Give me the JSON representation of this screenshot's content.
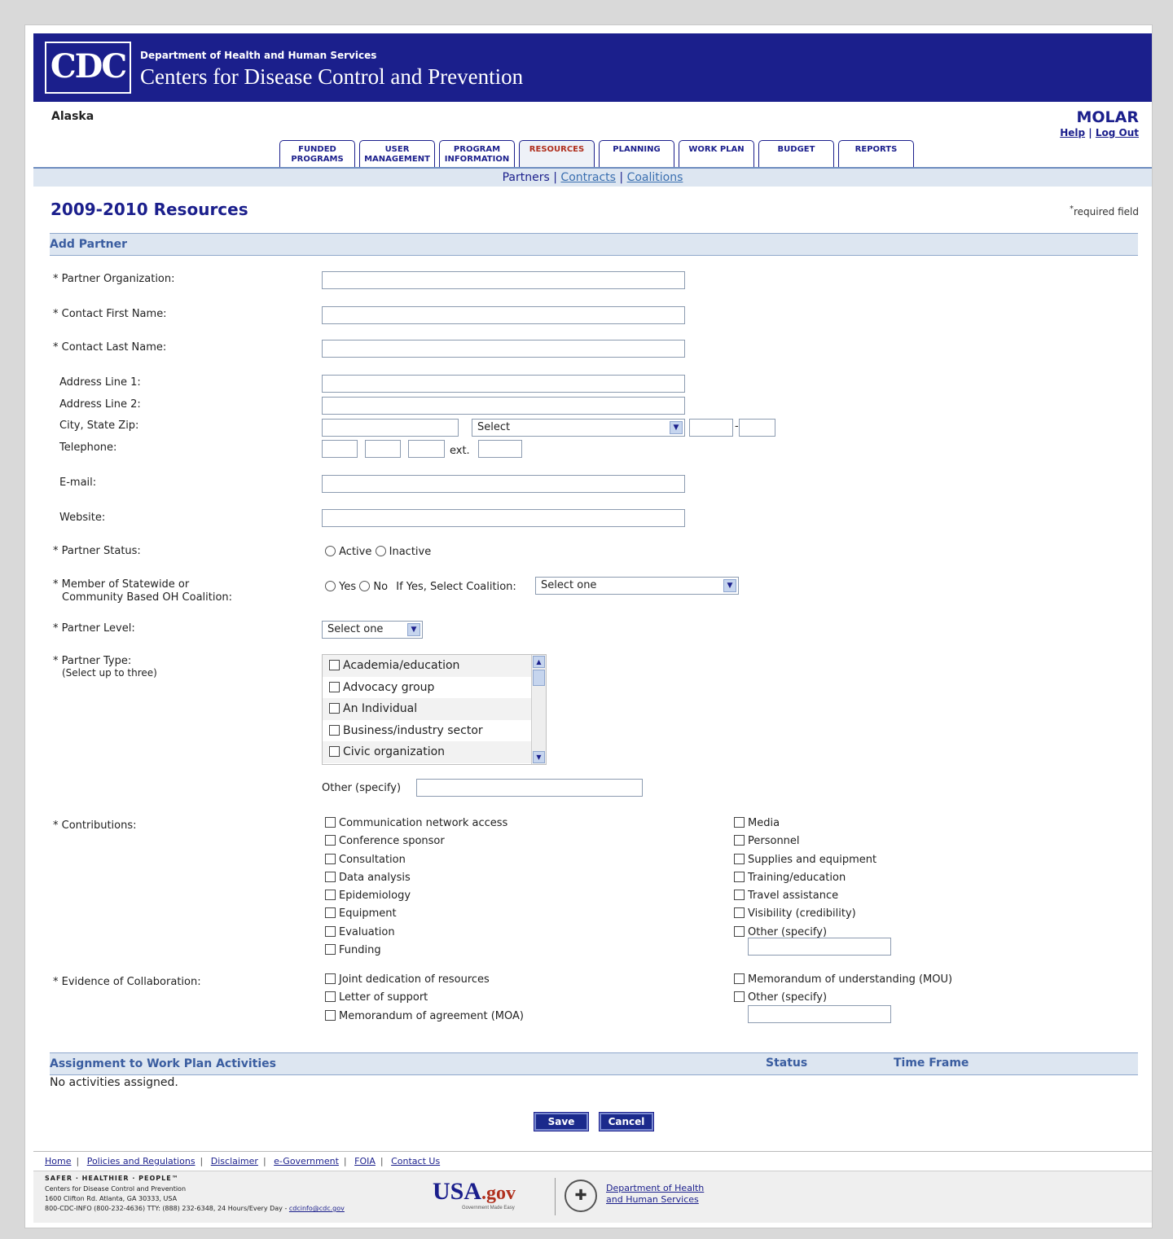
{
  "header": {
    "logo_text": "CDC",
    "department": "Department of Health and Human Services",
    "agency": "Centers for Disease Control and Prevention",
    "state": "Alaska",
    "app_name": "MOLAR",
    "help": "Help",
    "logout": "Log Out",
    "link_sep": "|"
  },
  "tabs": [
    {
      "line1": "FUNDED",
      "line2": "PROGRAMS"
    },
    {
      "line1": "USER",
      "line2": "MANAGEMENT"
    },
    {
      "line1": "PROGRAM",
      "line2": "INFORMATION"
    },
    {
      "line1": "RESOURCES",
      "line2": ""
    },
    {
      "line1": "PLANNING",
      "line2": ""
    },
    {
      "line1": "WORK PLAN",
      "line2": ""
    },
    {
      "line1": "BUDGET",
      "line2": ""
    },
    {
      "line1": "REPORTS",
      "line2": ""
    }
  ],
  "subnav": {
    "partners": "Partners",
    "contracts": "Contracts",
    "coalitions": "Coalitions",
    "sep": "|"
  },
  "page": {
    "title": "2009-2010 Resources",
    "required_note": "required field",
    "asterisk": "*",
    "section_add": "Add Partner"
  },
  "form": {
    "partner_org": "* Partner Organization:",
    "first_name": "* Contact First Name:",
    "last_name": "* Contact Last Name:",
    "addr1": "Address Line 1:",
    "addr2": "Address Line 2:",
    "city": "City, State Zip:",
    "state_select": "Select",
    "zip_dash": "-",
    "telephone": "Telephone:",
    "ext": "ext.",
    "email": "E-mail:",
    "website": "Website:",
    "status": "* Partner Status:",
    "active": "Active",
    "inactive": "Inactive",
    "member_l1": "* Member of Statewide or",
    "member_l2": "Community Based OH Coalition:",
    "yes": "Yes",
    "no": "No",
    "if_yes": "If Yes, Select Coalition:",
    "coalition_select": "Select one",
    "level": "* Partner Level:",
    "level_select": "Select one",
    "type": "* Partner Type:",
    "type_note": "(Select up to three)",
    "types": [
      "Academia/education",
      "Advocacy group",
      "An Individual",
      "Business/industry sector",
      "Civic organization"
    ],
    "other_specify": "Other (specify)",
    "contributions": "* Contributions:",
    "contrib_left": [
      "Communication network access",
      "Conference sponsor",
      "Consultation",
      "Data analysis",
      "Epidemiology",
      "Equipment",
      "Evaluation",
      "Funding"
    ],
    "contrib_right": [
      "Media",
      "Personnel",
      "Supplies and equipment",
      "Training/education",
      "Travel assistance",
      "Visibility (credibility)",
      "Other (specify)"
    ],
    "evidence": "* Evidence of Collaboration:",
    "evid_left": [
      "Joint dedication of resources",
      "Letter of support",
      "Memorandum of agreement (MOA)"
    ],
    "evid_right": [
      "Memorandum of understanding (MOU)",
      "Other (specify)"
    ]
  },
  "assignments": {
    "heading": "Assignment to Work Plan Activities",
    "status": "Status",
    "time_frame": "Time Frame",
    "empty": "No activities assigned."
  },
  "buttons": {
    "save": "Save",
    "cancel": "Cancel"
  },
  "footer": {
    "links": [
      "Home",
      "Policies and Regulations",
      "Disclaimer",
      "e-Government",
      "FOIA",
      "Contact Us"
    ],
    "sep": "|",
    "tagline": "SAFER · HEALTHIER · PEOPLE™",
    "addr1": "Centers for Disease Control and Prevention",
    "addr2": "1600 Clifton Rd. Atlanta, GA 30333, USA",
    "addr3": "800-CDC-INFO (800-232-4636) TTY: (888) 232-6348, 24 Hours/Every Day - ",
    "email": "cdcinfo@cdc.gov",
    "usa": "USA",
    "gov": ".gov",
    "usa_tag": "Government Made Easy",
    "hhs1": "Department of Health",
    "hhs2": "and Human Services"
  },
  "colors": {
    "brand": "#1b1f8c",
    "active_tab": "#b0301e",
    "section_bg": "#dde6f1"
  }
}
